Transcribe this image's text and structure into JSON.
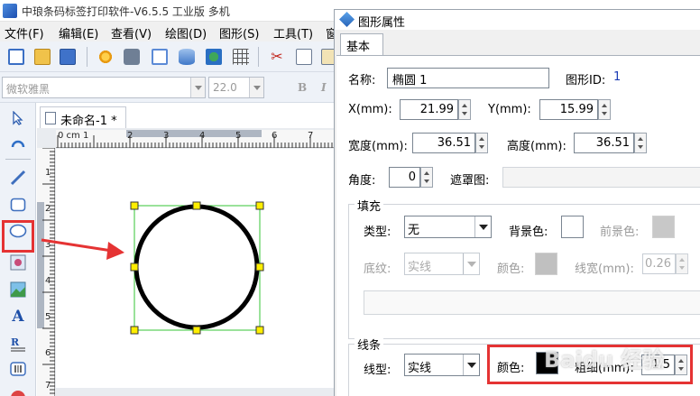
{
  "app": {
    "title": "中琅条码标签打印软件-V6.5.5 工业版 多机",
    "menus": [
      "文件(F)",
      "编辑(E)",
      "查看(V)",
      "绘图(D)",
      "图形(S)",
      "工具(T)",
      "窗"
    ]
  },
  "font_toolbar": {
    "font": "微软雅黑",
    "size": "22.0",
    "bold": "B",
    "italic": "I"
  },
  "document": {
    "tab_name": "未命名-1 *"
  },
  "ruler": {
    "unit_label": "0 cm 1",
    "h_labels": [
      "2",
      "3",
      "4",
      "5",
      "6",
      "7"
    ],
    "v_labels": [
      "1",
      "2",
      "3",
      "4",
      "5",
      "6",
      "7"
    ]
  },
  "dialog": {
    "title": "图形属性",
    "tab": "基本",
    "name_label": "名称:",
    "name_value": "椭圆 1",
    "shape_id_label": "图形ID:",
    "shape_id_value": "1",
    "x_label": "X(mm):",
    "x_value": "21.99",
    "y_label": "Y(mm):",
    "y_value": "15.99",
    "width_label": "宽度(mm):",
    "width_value": "36.51",
    "height_label": "高度(mm):",
    "height_value": "36.51",
    "angle_label": "角度:",
    "angle_value": "0",
    "mask_label": "遮罩图:",
    "fill": {
      "title": "填充",
      "type_label": "类型:",
      "type_value": "无",
      "bg_color_label": "背景色:",
      "fg_color_label": "前景色:",
      "texture_label": "底纹:",
      "texture_value": "实线",
      "color_label": "颜色:",
      "line_width_label": "线宽(mm):",
      "line_width_value": "0.26"
    },
    "line": {
      "title": "线条",
      "type_label": "线型:",
      "type_value": "实线",
      "color_label": "颜色:",
      "thickness_label": "粗细(mm):",
      "thickness_value": "1.5"
    }
  },
  "colors": {
    "highlight_red": "#e53333",
    "selection_green": "#35c635",
    "handle_yellow": "#ffee00",
    "line_color": "#000000",
    "fill_bg_color": "#ffffff",
    "fill_fg_color": "#c8c8c8"
  },
  "watermark": "Baidu 经验"
}
